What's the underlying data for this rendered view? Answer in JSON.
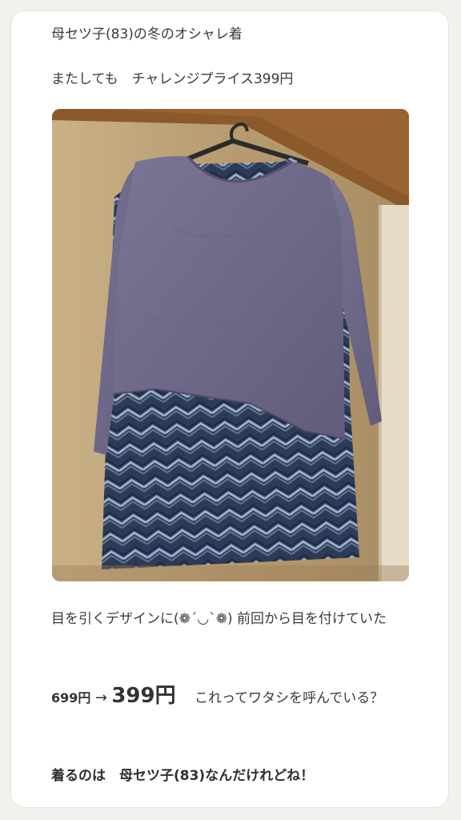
{
  "post": {
    "line1": "母セツ子(83)の冬のオシャレ着",
    "line2": "またしても　チャレンジプライス399円",
    "photo_alt": "ハンガーに掛かったラベンダー色のジグザグ柄トップス",
    "para1": "目を引くデザインに(❁´◡`❁)  前回から目を付けていた",
    "price_old": "699円",
    "price_arrow": "→",
    "price_new": "399円",
    "price_comment": "これってワタシを呼んでいる？",
    "closing": "着るのは　母セツ子(83)なんだけれどね！"
  },
  "colors": {
    "page_bg": "#f3f1ee",
    "card_bg": "#ffffff",
    "text": "#3a3a3a",
    "top_fabric": "#6f6989",
    "zigzag_dark": "#27344f",
    "zigzag_light": "#9fb0c9",
    "wall": "#c0a67c"
  }
}
